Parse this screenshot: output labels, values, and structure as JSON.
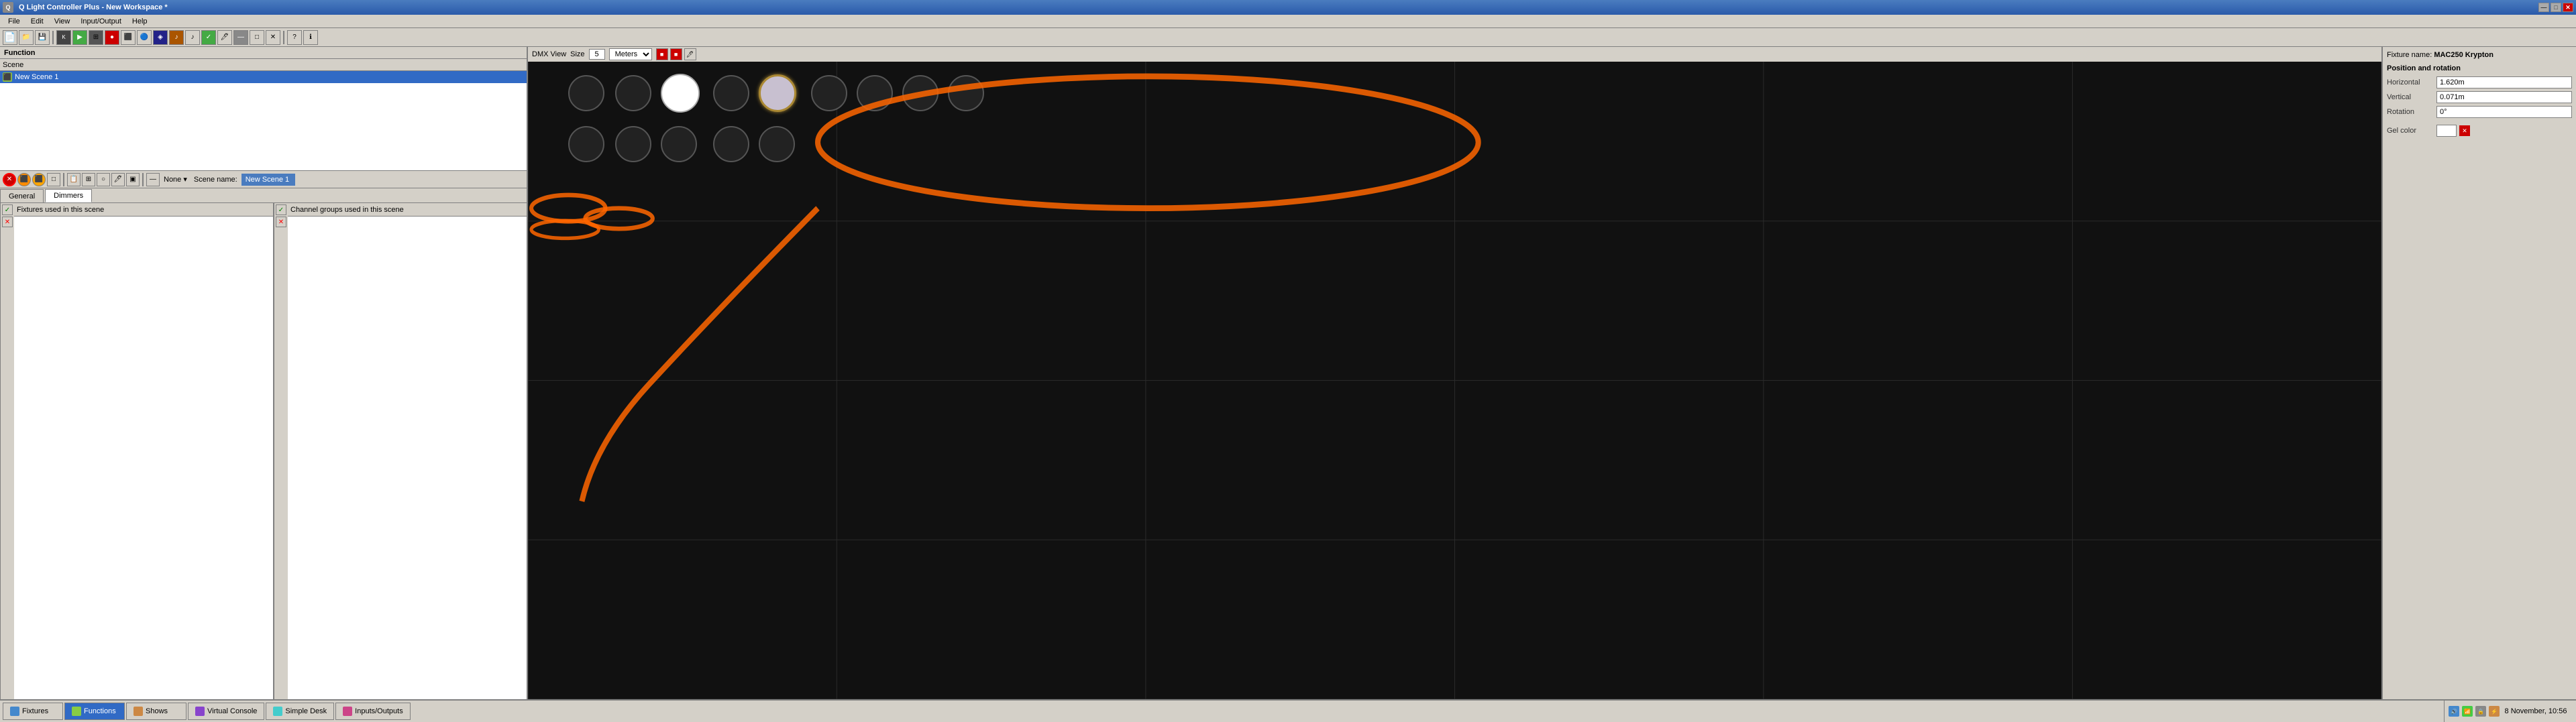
{
  "app": {
    "title": "Q Light Controller Plus - New Workspace *",
    "version": "Q Light Controller Plus"
  },
  "titlebar": {
    "title": "Q Light Controller Plus - New Workspace *",
    "minimize": "—",
    "maximize": "□",
    "close": "✕"
  },
  "menu": {
    "items": [
      "File",
      "Edit",
      "View",
      "Input/Output",
      "Help"
    ]
  },
  "function_panel": {
    "label": "Function",
    "scene_label": "Scene",
    "scene_name": "Scene 1"
  },
  "editor": {
    "scene_name_label": "Scene name:",
    "scene_name_value": "New Scene 1",
    "tabs": [
      "General",
      "Dimmers"
    ],
    "active_tab": "Dimmers",
    "fixtures_header": "Fixtures used in this scene",
    "channels_header": "Channel groups used in this scene"
  },
  "dmx_view": {
    "label": "DMX View",
    "size_label": "Size",
    "size_value": "5",
    "units": "Meters",
    "fixture_name": "MAC250 Krypton",
    "position": {
      "title": "Position and rotation",
      "horizontal_label": "Horizontal",
      "horizontal_value": "1.620m",
      "vertical_label": "Vertical",
      "vertical_value": "0.071m",
      "rotation_label": "Rotation",
      "rotation_value": "0°"
    },
    "gel_color_label": "Gel color"
  },
  "fixtures": [
    {
      "row": 0,
      "col": 0,
      "state": "dim",
      "id": 1
    },
    {
      "row": 0,
      "col": 1,
      "state": "dim",
      "id": 2
    },
    {
      "row": 0,
      "col": 2,
      "state": "active",
      "id": 3
    },
    {
      "row": 0,
      "col": 3,
      "state": "dim",
      "id": 4
    },
    {
      "row": 0,
      "col": 4,
      "state": "selected",
      "id": 5
    },
    {
      "row": 0,
      "col": 5,
      "state": "dim",
      "id": 6
    },
    {
      "row": 0,
      "col": 6,
      "state": "dim",
      "id": 7
    },
    {
      "row": 0,
      "col": 7,
      "state": "dim",
      "id": 8
    },
    {
      "row": 0,
      "col": 8,
      "state": "dim",
      "id": 9
    },
    {
      "row": 1,
      "col": 0,
      "state": "dim",
      "id": 10
    },
    {
      "row": 1,
      "col": 1,
      "state": "dim",
      "id": 11
    },
    {
      "row": 1,
      "col": 2,
      "state": "dim",
      "id": 12
    },
    {
      "row": 1,
      "col": 3,
      "state": "dim",
      "id": 13
    },
    {
      "row": 1,
      "col": 4,
      "state": "dim",
      "id": 14
    }
  ],
  "taskbar": {
    "tabs": [
      {
        "label": "Fixtures",
        "active": false,
        "icon": "fixture-icon"
      },
      {
        "label": "Functions",
        "active": true,
        "icon": "function-icon"
      },
      {
        "label": "Shows",
        "active": false,
        "icon": "show-icon"
      },
      {
        "label": "Virtual Console",
        "active": false,
        "icon": "console-icon"
      },
      {
        "label": "Simple Desk",
        "active": false,
        "icon": "desk-icon"
      },
      {
        "label": "Inputs/Outputs",
        "active": false,
        "icon": "io-icon"
      }
    ],
    "clock": "8 November, 10:56"
  }
}
